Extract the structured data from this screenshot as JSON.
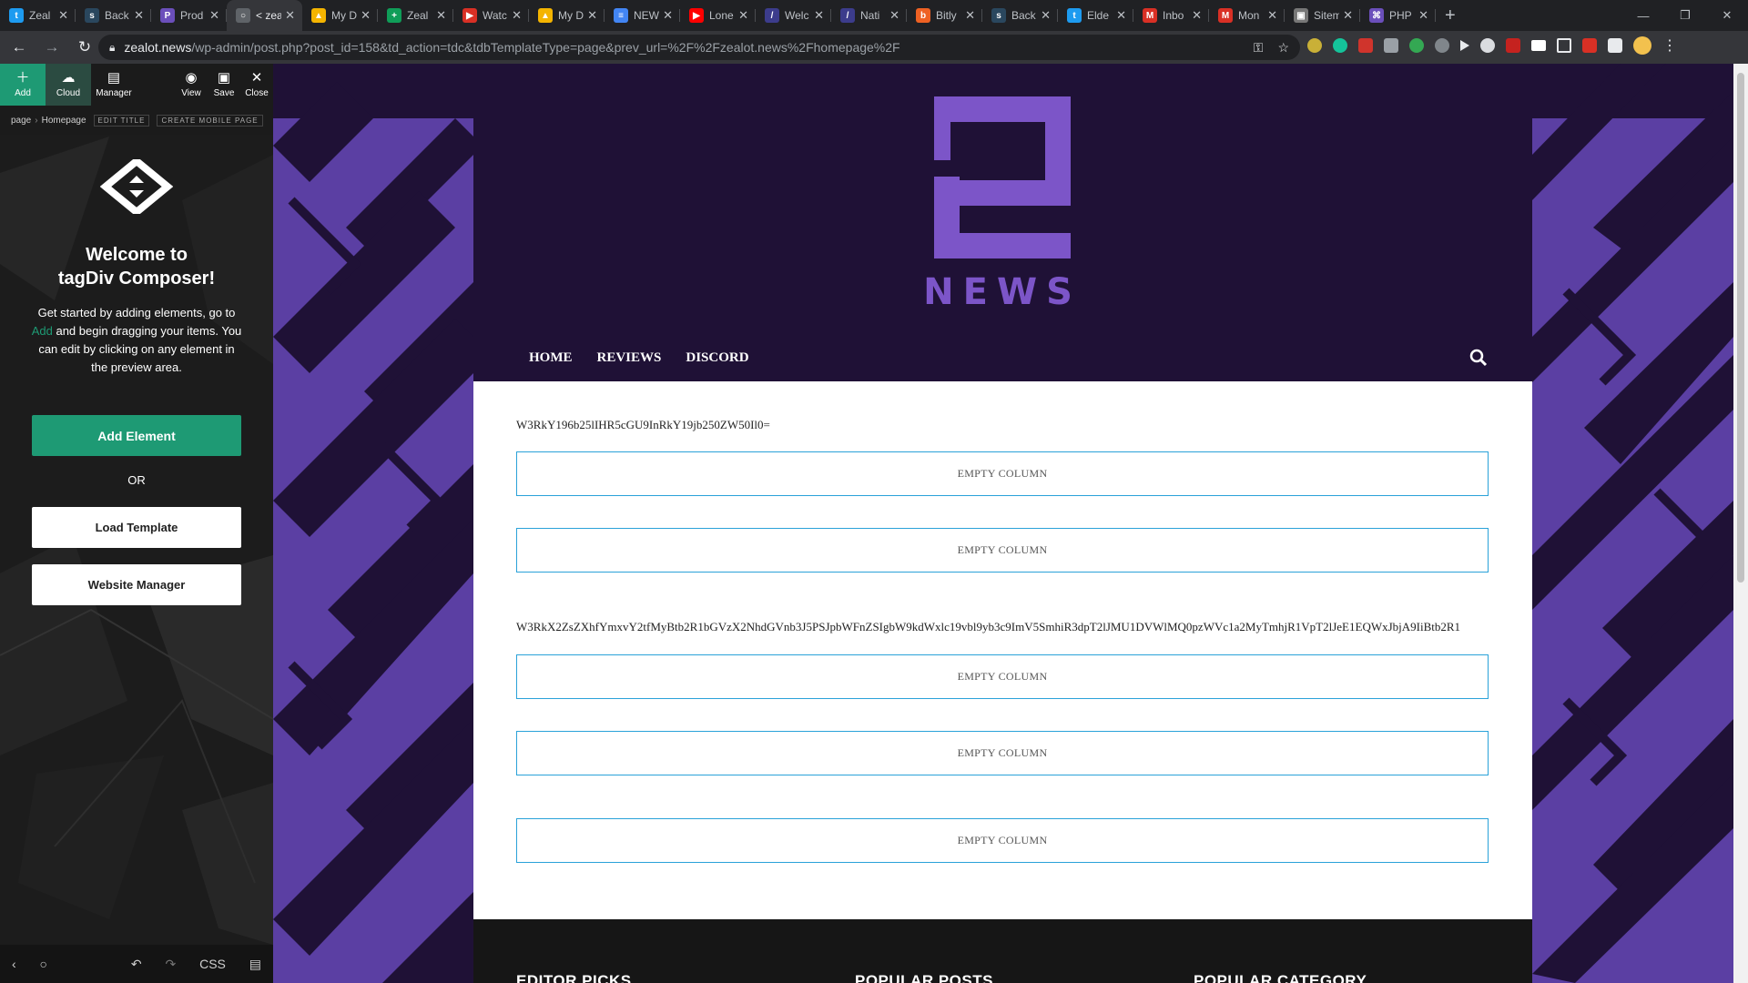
{
  "browser": {
    "tabs": [
      {
        "title": "Zeal",
        "color": "#1d9bf0",
        "glyph": "t"
      },
      {
        "title": "Back",
        "color": "#2a475e",
        "glyph": "s"
      },
      {
        "title": "Prod",
        "color": "#6b4fbb",
        "glyph": "P"
      },
      {
        "title": "< zea",
        "color": "#5f6368",
        "glyph": "○",
        "active": true
      },
      {
        "title": "My D",
        "color": "#f4b400",
        "glyph": "▲"
      },
      {
        "title": "Zeal",
        "color": "#0f9d58",
        "glyph": "+"
      },
      {
        "title": "Watc",
        "color": "#d93025",
        "glyph": "▶"
      },
      {
        "title": "My D",
        "color": "#f4b400",
        "glyph": "▲"
      },
      {
        "title": "NEW",
        "color": "#4285f4",
        "glyph": "≡"
      },
      {
        "title": "Lone",
        "color": "#ff0000",
        "glyph": "▶"
      },
      {
        "title": "Welc",
        "color": "#3c3c8c",
        "glyph": "/"
      },
      {
        "title": "Nati",
        "color": "#3c3c8c",
        "glyph": "/"
      },
      {
        "title": "Bitly",
        "color": "#ee6123",
        "glyph": "b"
      },
      {
        "title": "Back",
        "color": "#2a475e",
        "glyph": "s"
      },
      {
        "title": "Elde",
        "color": "#1d9bf0",
        "glyph": "t"
      },
      {
        "title": "Inbo",
        "color": "#d93025",
        "glyph": "M"
      },
      {
        "title": "Mon",
        "color": "#d93025",
        "glyph": "M"
      },
      {
        "title": "Sitem",
        "color": "#777777",
        "glyph": "▣"
      },
      {
        "title": "PHP",
        "color": "#6b4fbb",
        "glyph": "⌘"
      }
    ],
    "url_host": "zealot.news",
    "url_path": "/wp-admin/post.php?post_id=158&td_action=tdc&tdbTemplateType=page&prev_url=%2F%2Fzealot.news%2Fhomepage%2F"
  },
  "composer": {
    "toolbar": {
      "add": "Add",
      "cloud": "Cloud",
      "manager": "Manager",
      "view": "View",
      "save": "Save",
      "close": "Close"
    },
    "breadcrumb": {
      "root": "page",
      "current": "Homepage",
      "edit_title": "EDIT TITLE",
      "create_mobile": "CREATE MOBILE PAGE"
    },
    "welcome_line1": "Welcome to",
    "welcome_line2": "tagDiv Composer!",
    "intro_before": "Get started by adding elements, go to",
    "intro_link": "Add",
    "intro_after": "and begin dragging your items. You can edit by clicking on any element in the preview area.",
    "add_element": "Add Element",
    "or": "OR",
    "load_template": "Load Template",
    "website_manager": "Website Manager",
    "bottom": {
      "css": "CSS"
    }
  },
  "site": {
    "logo_text": "NEWS",
    "menu": [
      "HOME",
      "REVIEWS",
      "DISCORD"
    ],
    "code_line_1": "W3RkY196b25lIHR5cGU9InRkY19jb250ZW50Il0=",
    "code_line_2": "W3RkX2ZsZXhfYmxvY2tfMyBtb2R1bGVzX2NhdGVnb3J5PSJpbWFnZSIgbW9kdWxlc19vbl9yb3c9ImV5SmhiR3dpT2lJMU1DVWlMQ0pzWVc1a2MyTmhjR1VpT2lJeE1EQWxJbjA9IiBtb2R1",
    "empty_column": "EMPTY COLUMN",
    "footer": [
      "EDITOR PICKS",
      "POPULAR POSTS",
      "POPULAR CATEGORY"
    ]
  },
  "colors": {
    "accent_green": "#1e9a74",
    "site_purple": "#7c55c8",
    "header_dark": "#1f1136",
    "column_border": "#2aa2d9"
  }
}
